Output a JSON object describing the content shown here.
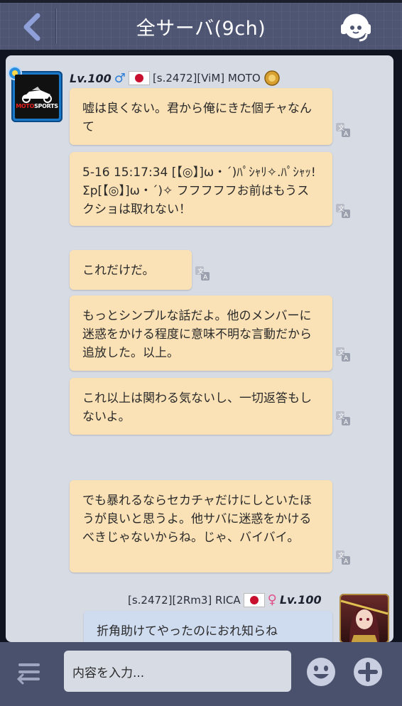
{
  "header": {
    "title": "全サーバ(9ch)"
  },
  "messages": [
    {
      "sender": "moto",
      "level": "Lv.100",
      "name": "[s.2472][ViM] MOTO",
      "texts": [
        "嘘は良くない。君から俺にきた個チャなんて",
        "5-16 15:17:34 [【◎】]ω・´)ﾊﾟｼｬﾘ✧.ﾊﾟｼｬｯ! Σp[【◎】]ω・´)✧ フフフフフお前はもうスクショは取れない！",
        "これだけだ。",
        "もっとシンプルな話だよ。他のメンバーに迷惑をかける程度に意味不明な言動だから追放した。以上。",
        "これ以上は関わる気ないし、一切返答もしないよ。",
        "でも暴れるならセカチャだけにしといたほうが良いと思うよ。他サバに迷惑をかけるべきじゃないからね。じゃ、バイバイ。"
      ]
    },
    {
      "sender": "rica",
      "level": "Lv.100",
      "name": "[s.2472][2Rm3] RICA",
      "texts": [
        "折角助けてやったのにおれ知らね"
      ]
    }
  ],
  "avatar_moto": {
    "brand_a": "MOTO",
    "brand_b": "SPORTS"
  },
  "input": {
    "placeholder": "内容を入力..."
  },
  "icons": {
    "back": "chevron-left-icon",
    "support": "headset-icon",
    "menu": "menu-switch-icon",
    "emoji": "smiley-icon",
    "plus": "plus-icon",
    "translate": "translate-icon"
  },
  "colors": {
    "header_bg": "#4e5573",
    "panel_bg": "#d7dbe4",
    "bubble_self": "#fbe2b6",
    "bubble_other": "#cfdcf0",
    "bottom_bg": "#4a516d"
  }
}
